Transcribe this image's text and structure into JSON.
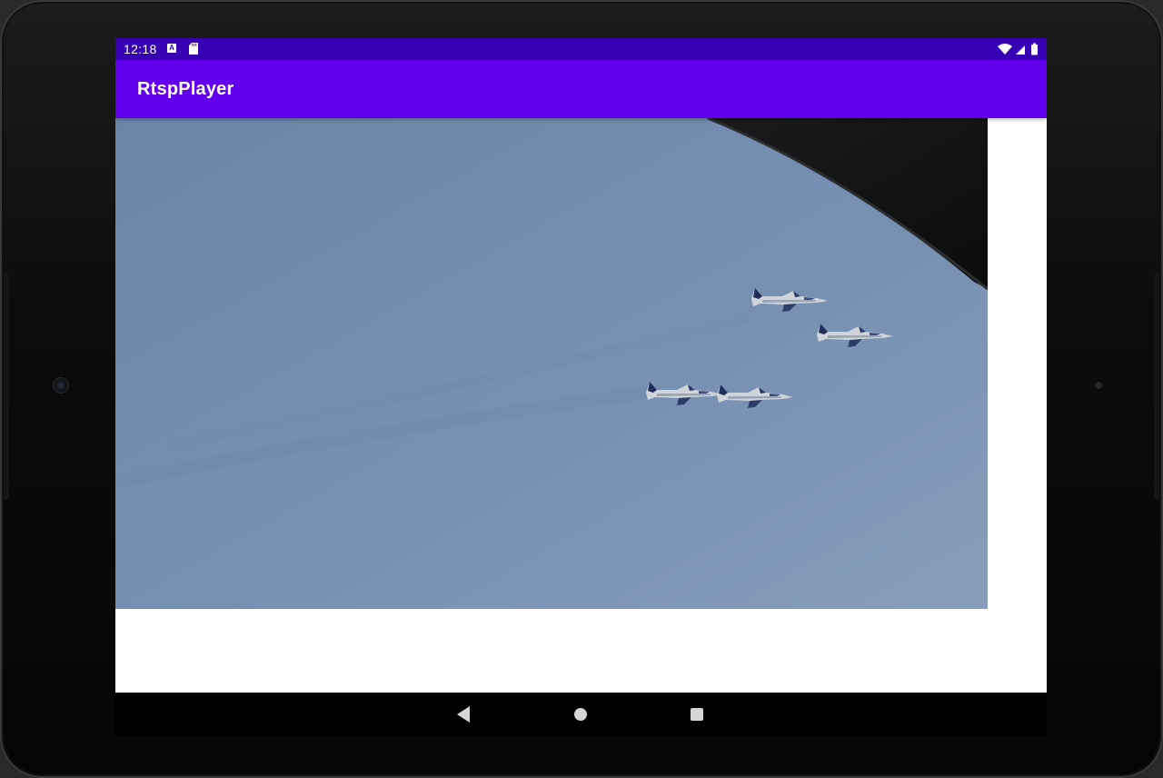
{
  "status_bar": {
    "time": "12:18",
    "icons_left": [
      "app-notification-icon",
      "sd-card-icon"
    ],
    "icons_right": [
      "wifi-icon",
      "cell-signal-icon",
      "battery-icon"
    ]
  },
  "app_bar": {
    "title": "RtspPlayer",
    "background": "#6200EE",
    "status_background": "#3700B3"
  },
  "video": {
    "content": "video-frame",
    "subject_icon": "jet-formation"
  },
  "nav_bar": {
    "buttons": [
      "back-icon",
      "home-icon",
      "recents-icon"
    ]
  }
}
